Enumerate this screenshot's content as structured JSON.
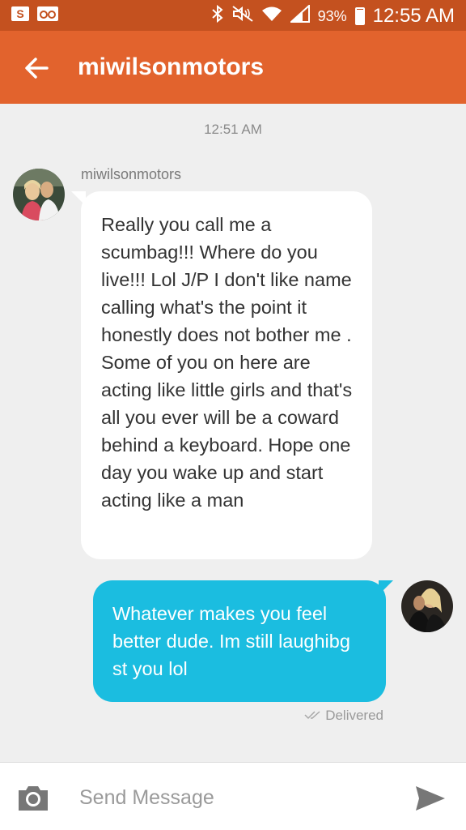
{
  "status_bar": {
    "left_icons": [
      "samsung-s-icon",
      "voicemail-icon"
    ],
    "right_icons": [
      "bluetooth-icon",
      "mute-icon",
      "wifi-icon",
      "signal-icon",
      "battery-icon"
    ],
    "battery_level": 0.93,
    "battery_text": "93%",
    "time": "12:55 AM"
  },
  "app_bar": {
    "title": "miwilsonmotors",
    "color": "#e2632d",
    "status_color": "#c4511f"
  },
  "conversation": {
    "timestamp": "12:51 AM",
    "incoming": {
      "sender": "miwilsonmotors",
      "text": "Really you call me a scumbag!!! Where do you live!!! Lol J/P I don't like name calling what's the point it honestly does not bother me . Some of you on here are acting like little girls and that's all you ever will be a coward behind a keyboard. Hope one day you wake up and start acting like a man"
    },
    "outgoing": {
      "text": "Whatever makes you feel better dude.  Im still laughibg st you lol",
      "status": "Delivered",
      "bubble_color": "#1bbde0"
    }
  },
  "composer": {
    "placeholder": "Send Message",
    "value": ""
  }
}
